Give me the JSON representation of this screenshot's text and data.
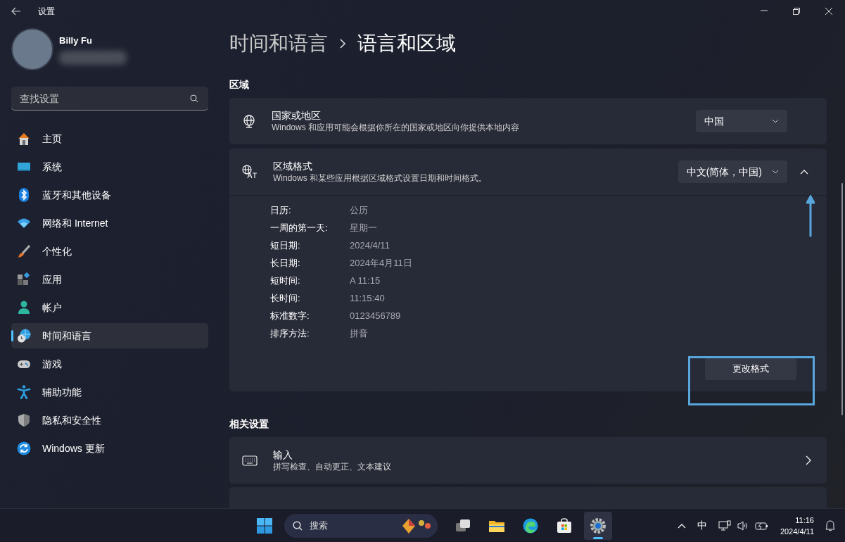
{
  "window": {
    "title": "设置"
  },
  "user": {
    "name": "Billy Fu"
  },
  "search": {
    "placeholder": "查找设置"
  },
  "nav": [
    {
      "label": "主页",
      "selected": false
    },
    {
      "label": "系统",
      "selected": false
    },
    {
      "label": "蓝牙和其他设备",
      "selected": false
    },
    {
      "label": "网络和 Internet",
      "selected": false
    },
    {
      "label": "个性化",
      "selected": false
    },
    {
      "label": "应用",
      "selected": false
    },
    {
      "label": "帐户",
      "selected": false
    },
    {
      "label": "时间和语言",
      "selected": true
    },
    {
      "label": "游戏",
      "selected": false
    },
    {
      "label": "辅助功能",
      "selected": false
    },
    {
      "label": "隐私和安全性",
      "selected": false
    },
    {
      "label": "Windows 更新",
      "selected": false
    }
  ],
  "breadcrumb": [
    "时间和语言",
    "语言和区域"
  ],
  "region": {
    "heading": "区域",
    "country": {
      "title": "国家或地区",
      "description": "Windows 和应用可能会根据你所在的国家或地区向你提供本地内容",
      "value": "中国"
    },
    "format": {
      "title": "区域格式",
      "description": "Windows 和某些应用根据区域格式设置日期和时间格式。",
      "value": "中文(简体，中国)",
      "expanded": true,
      "details": [
        {
          "label": "日历:",
          "value": "公历"
        },
        {
          "label": "一周的第一天:",
          "value": "星期一"
        },
        {
          "label": "短日期:",
          "value": "2024/4/11"
        },
        {
          "label": "长日期:",
          "value": "2024年4月11日"
        },
        {
          "label": "短时间:",
          "value": "A 11:15"
        },
        {
          "label": "长时间:",
          "value": "11:15:40"
        },
        {
          "label": "标准数字:",
          "value": "0123456789"
        },
        {
          "label": "排序方法:",
          "value": "拼音"
        }
      ],
      "button": "更改格式"
    }
  },
  "related": {
    "heading": "相关设置",
    "items": [
      {
        "title": "输入",
        "description": "拼写检查、自动更正、文本建议"
      }
    ]
  },
  "taskbar": {
    "search": {
      "placeholder": "搜索"
    },
    "apps": [
      {
        "selected": false
      },
      {
        "selected": false
      },
      {
        "selected": false
      },
      {
        "selected": false
      },
      {
        "selected": true
      }
    ],
    "ime": "中",
    "time": "11:16",
    "date": "2024/4/11"
  }
}
